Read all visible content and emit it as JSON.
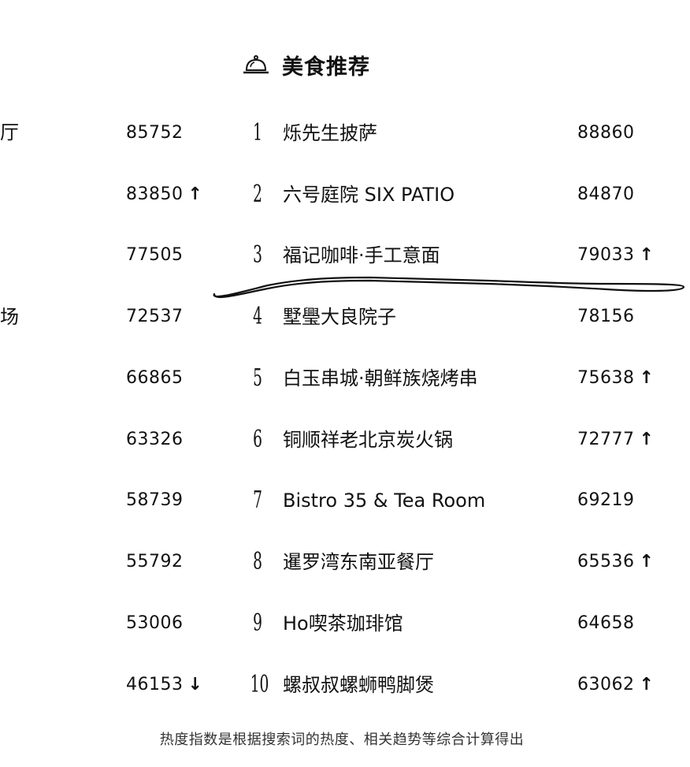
{
  "header": {
    "title": "美食推荐",
    "icon": "cloche-icon"
  },
  "left_fragments": [
    {
      "text": "厅"
    },
    {
      "text": "场"
    }
  ],
  "rows": [
    {
      "prev_score": "85752",
      "prev_arrow": "",
      "rank": "1",
      "name": "烁先生披萨",
      "score": "88860",
      "score_arrow": ""
    },
    {
      "prev_score": "83850",
      "prev_arrow": "↑",
      "rank": "2",
      "name": "六号庭院 SIX PATIO",
      "score": "84870",
      "score_arrow": ""
    },
    {
      "prev_score": "77505",
      "prev_arrow": "",
      "rank": "3",
      "name": "福记咖啡·手工意面",
      "score": "79033",
      "score_arrow": "↑"
    },
    {
      "prev_score": "72537",
      "prev_arrow": "",
      "rank": "4",
      "name": "墅璺大良院子",
      "score": "78156",
      "score_arrow": ""
    },
    {
      "prev_score": "66865",
      "prev_arrow": "",
      "rank": "5",
      "name": "白玉串城·朝鲜族烧烤串",
      "score": "75638",
      "score_arrow": "↑"
    },
    {
      "prev_score": "63326",
      "prev_arrow": "",
      "rank": "6",
      "name": "铜顺祥老北京炭火锅",
      "score": "72777",
      "score_arrow": "↑"
    },
    {
      "prev_score": "58739",
      "prev_arrow": "",
      "rank": "7",
      "name": "Bistro 35 & Tea Room",
      "score": "69219",
      "score_arrow": ""
    },
    {
      "prev_score": "55792",
      "prev_arrow": "",
      "rank": "8",
      "name": "暹罗湾东南亚餐厅",
      "score": "65536",
      "score_arrow": "↑"
    },
    {
      "prev_score": "53006",
      "prev_arrow": "",
      "rank": "9",
      "name": "Ho喫茶珈琲馆",
      "score": "64658",
      "score_arrow": ""
    },
    {
      "prev_score": "46153",
      "prev_arrow": "↓",
      "rank": "10",
      "name": "螺叔叔螺蛳鸭脚煲",
      "score": "63062",
      "score_arrow": "↑"
    }
  ],
  "footer": {
    "text": "热度指数是根据搜索词的热度、相关趋势等综合计算得出"
  }
}
